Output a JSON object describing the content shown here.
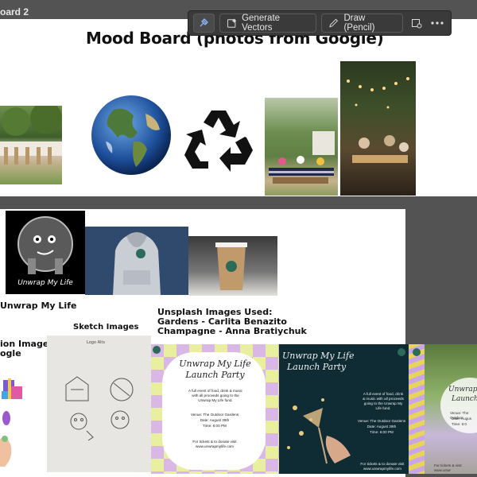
{
  "artboard": {
    "name": "oard 2"
  },
  "toolbar": {
    "generate_vectors": "Generate Vectors",
    "draw_pencil": "Draw (Pencil)",
    "icons": [
      "pin-icon",
      "generate-vectors-icon",
      "pencil-icon",
      "image-settings-icon",
      "more-icon"
    ]
  },
  "moodboard": {
    "title": "Mood Board (photos from Google)"
  },
  "labels": {
    "unwrap_my_life": "Unwrap My Life",
    "unsplash_heading": "Unsplash Images Used:",
    "unsplash_line1": "Gardens - Carlita Benazito",
    "unsplash_line2": "Champagne - Anna Bratiychuk",
    "sketch_images": "Sketch Images",
    "illustration_images_1": "ion Images",
    "illustration_images_2": "ogle"
  },
  "logo": {
    "caption": "Unwrap My Life"
  },
  "sketch": {
    "header": "Logo    Alts"
  },
  "invite1": {
    "title_line1": "Unwrap My Life",
    "title_line2": "Launch Party",
    "body": "A full event of food, drink & music with all proceeds going to the Unwrap My Life fund.",
    "venue": "Venue: The Outdoor Gardens",
    "date": "Date: August 29th",
    "time": "Time: 6:00 PM",
    "tickets": "For tickets & to donate visit www.unwrapmylife.com"
  },
  "invite2": {
    "title_line1": "Unwrap My Life",
    "title_line2": "Launch Party",
    "body": "A full event of food, drink & music with all proceeds going to the Unwrap My Life fund.",
    "venue": "Venue: The Outdoor Gardens",
    "date": "Date: August 29th",
    "time": "Time: 6:00 PM",
    "tickets": "For tickets & to donate visit www.unwrapmylife.com"
  },
  "invite3": {
    "title_line1": "Unwrap",
    "title_line2": "Launch",
    "venue": "Venue: The Outdoor",
    "date": "Date: Augus",
    "time": "Time: 6:0",
    "tickets": "For tickets & visit www.unwr"
  }
}
